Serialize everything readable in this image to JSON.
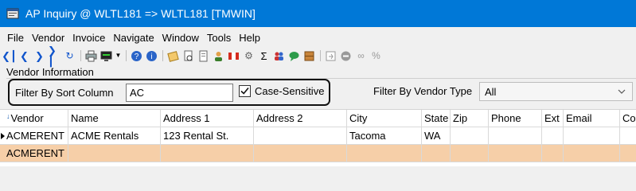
{
  "window": {
    "title": "AP Inquiry @ WLTL181 => WLTL181 [TMWIN]",
    "app_icon": "window-app-icon"
  },
  "menu": [
    "File",
    "Vendor",
    "Invoice",
    "Navigate",
    "Window",
    "Tools",
    "Help"
  ],
  "toolbar": {
    "groups": [
      [
        "first-record-icon",
        "previous-record-icon",
        "next-record-icon",
        "last-record-icon",
        "refresh-icon"
      ],
      [
        "print-icon",
        "screen-output-icon",
        "dropdown-arrow-icon"
      ],
      [
        "help-icon",
        "info-icon"
      ],
      [
        "notes-icon",
        "print-preview-icon",
        "document-icon",
        "user-icon",
        "flag-icon",
        "settings-icon",
        "sum-icon",
        "people-icon",
        "chat-icon",
        "cabinet-icon"
      ],
      [
        "export-icon",
        "stop-icon",
        "link-icon",
        "percent-icon"
      ]
    ]
  },
  "vendor_info": {
    "group_label": "Vendor Information",
    "filter_label": "Filter By Sort Column",
    "filter_value": "AC",
    "case_sensitive_label": "Case-Sensitive",
    "case_sensitive_checked": true,
    "vendor_type_label": "Filter By Vendor Type",
    "vendor_type_value": "All"
  },
  "grid": {
    "columns": [
      "Vendor",
      "Name",
      "Address 1",
      "Address 2",
      "City",
      "State",
      "Zip",
      "Phone",
      "Ext",
      "Email",
      "Co"
    ],
    "sorted_column": "Vendor",
    "rows": [
      {
        "vendor": "ACMERENT",
        "name": "ACME Rentals",
        "address1": "123 Rental St.",
        "address2": "",
        "city": "Tacoma",
        "state": "WA",
        "zip": "",
        "phone": "",
        "ext": "",
        "email": "",
        "co": ""
      },
      {
        "vendor": "ACMERENT",
        "name": "",
        "address1": "",
        "address2": "",
        "city": "",
        "state": "",
        "zip": "",
        "phone": "",
        "ext": "",
        "email": "",
        "co": ""
      }
    ],
    "selected_row_color": "#f6cfa8"
  },
  "colors": {
    "titlebar": "#0078d7",
    "accent": "#1155cc"
  }
}
